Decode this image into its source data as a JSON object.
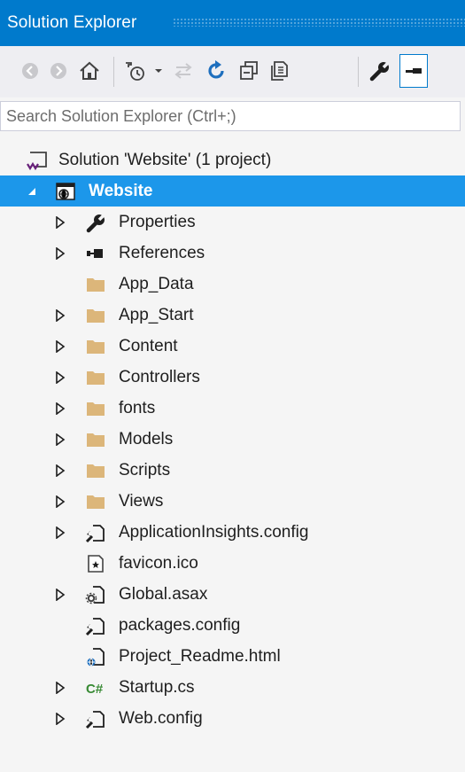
{
  "window": {
    "title": "Solution Explorer"
  },
  "toolbar": {
    "buttons": [
      {
        "name": "back-button",
        "icon": "circle-back-icon"
      },
      {
        "name": "forward-button",
        "icon": "circle-forward-icon"
      },
      {
        "name": "home-button",
        "icon": "home-icon"
      },
      {
        "name": "pending-changes-filter-button",
        "icon": "clock-filter-icon"
      },
      {
        "name": "sync-with-active-document-button",
        "icon": "sync-icon"
      },
      {
        "name": "refresh-button",
        "icon": "refresh-icon"
      },
      {
        "name": "collapse-all-button",
        "icon": "collapse-all-icon"
      },
      {
        "name": "show-all-files-button",
        "icon": "show-all-files-icon"
      },
      {
        "name": "properties-button",
        "icon": "wrench-icon"
      },
      {
        "name": "preview-selected-items-button",
        "icon": "preview-icon"
      }
    ]
  },
  "search": {
    "placeholder": "Search Solution Explorer (Ctrl+;)",
    "value": ""
  },
  "tree": {
    "solution_label": "Solution 'Website' (1 project)",
    "project_label": "Website",
    "items": [
      {
        "label": "Properties",
        "icon": "wrench-icon",
        "expandable": true
      },
      {
        "label": "References",
        "icon": "references-icon",
        "expandable": true
      },
      {
        "label": "App_Data",
        "icon": "folder-icon",
        "expandable": false
      },
      {
        "label": "App_Start",
        "icon": "folder-icon",
        "expandable": true
      },
      {
        "label": "Content",
        "icon": "folder-icon",
        "expandable": true
      },
      {
        "label": "Controllers",
        "icon": "folder-icon",
        "expandable": true
      },
      {
        "label": "fonts",
        "icon": "folder-icon",
        "expandable": true
      },
      {
        "label": "Models",
        "icon": "folder-icon",
        "expandable": true
      },
      {
        "label": "Scripts",
        "icon": "folder-icon",
        "expandable": true
      },
      {
        "label": "Views",
        "icon": "folder-icon",
        "expandable": true
      },
      {
        "label": "ApplicationInsights.config",
        "icon": "config-file-icon",
        "expandable": true
      },
      {
        "label": "favicon.ico",
        "icon": "icon-file-icon",
        "expandable": false
      },
      {
        "label": "Global.asax",
        "icon": "global-asax-icon",
        "expandable": true
      },
      {
        "label": "packages.config",
        "icon": "config-file-icon",
        "expandable": false
      },
      {
        "label": "Project_Readme.html",
        "icon": "html-file-icon",
        "expandable": false
      },
      {
        "label": "Startup.cs",
        "icon": "csharp-file-icon",
        "expandable": true
      },
      {
        "label": "Web.config",
        "icon": "config-file-icon",
        "expandable": true
      }
    ]
  },
  "colors": {
    "title_bar": "#007acc",
    "selection": "#1c97ea",
    "folder": "#dcb67a",
    "csharp": "#388a34",
    "background": "#f5f5f5"
  }
}
